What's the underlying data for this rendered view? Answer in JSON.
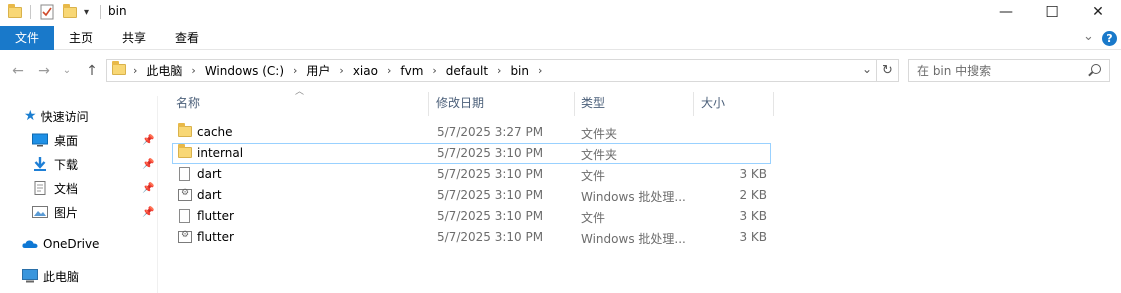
{
  "window": {
    "title": "bin",
    "minimize": "—",
    "maximize": "☐",
    "close": "✕"
  },
  "ribbon": {
    "tabs": [
      "文件",
      "主页",
      "共享",
      "查看"
    ],
    "expand": "⌄",
    "help": "?"
  },
  "address": {
    "segments": [
      "此电脑",
      "Windows (C:)",
      "用户",
      "xiao",
      "fvm",
      "default",
      "bin"
    ],
    "dropdown": "⌄",
    "refresh": "↻"
  },
  "search": {
    "placeholder": "在 bin 中搜索"
  },
  "nav": {
    "quick_access": "快速访问",
    "items": [
      {
        "label": "桌面",
        "icon": "desktop-icon",
        "pinned": true
      },
      {
        "label": "下载",
        "icon": "download-icon",
        "pinned": true
      },
      {
        "label": "文档",
        "icon": "document-icon",
        "pinned": true
      },
      {
        "label": "图片",
        "icon": "picture-icon",
        "pinned": true
      }
    ],
    "onedrive": "OneDrive",
    "this_pc": "此电脑"
  },
  "columns": {
    "name": "名称",
    "date": "修改日期",
    "type": "类型",
    "size": "大小"
  },
  "files": [
    {
      "name": "cache",
      "date": "5/7/2025 3:27 PM",
      "type": "文件夹",
      "size": "",
      "icon": "folder-icon"
    },
    {
      "name": "internal",
      "date": "5/7/2025 3:10 PM",
      "type": "文件夹",
      "size": "",
      "icon": "folder-icon"
    },
    {
      "name": "dart",
      "date": "5/7/2025 3:10 PM",
      "type": "文件",
      "size": "3 KB",
      "icon": "file-icon"
    },
    {
      "name": "dart",
      "date": "5/7/2025 3:10 PM",
      "type": "Windows 批处理...",
      "size": "2 KB",
      "icon": "batch-file-icon"
    },
    {
      "name": "flutter",
      "date": "5/7/2025 3:10 PM",
      "type": "文件",
      "size": "3 KB",
      "icon": "file-icon"
    },
    {
      "name": "flutter",
      "date": "5/7/2025 3:10 PM",
      "type": "Windows 批处理...",
      "size": "3 KB",
      "icon": "batch-file-icon"
    }
  ],
  "colors": {
    "file_tab": "#1979ca",
    "folder": "#f8d775",
    "focus_border": "#99d1ff"
  }
}
